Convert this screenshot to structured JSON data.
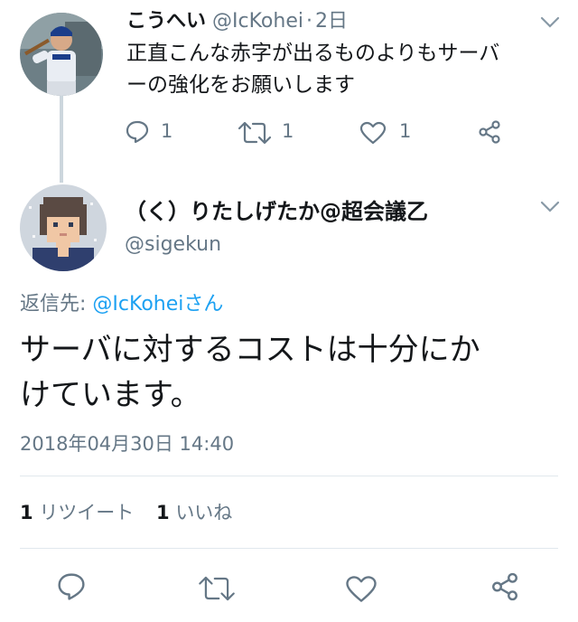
{
  "parent_tweet": {
    "display_name": "こうへい",
    "handle": "@IcKohei",
    "separator": "·",
    "time": "2日",
    "text_line1": "正直こんな赤字が出るものよりもサーバ",
    "text_line2": "ーの強化をお願いします",
    "reply_count": "1",
    "retweet_count": "1",
    "like_count": "1"
  },
  "main_tweet": {
    "display_name": "（く）りたしげたか@超会議乙",
    "handle": "@sigekun",
    "reply_to_label": "返信先: ",
    "reply_to_handle": "@IcKohei",
    "reply_to_suffix": "さん",
    "text_line1": "サーバに対するコストは十分にか",
    "text_line2": "けています。",
    "timestamp": "2018年04月30日 14:40",
    "retweet_count": "1",
    "retweet_label": "リツイート",
    "like_count": "1",
    "like_label": "いいね"
  },
  "colors": {
    "link": "#1da1f2",
    "muted": "#657786",
    "thread_line": "#ccd6dd",
    "divider": "#e1e8ed"
  },
  "icons": [
    "reply-icon",
    "retweet-icon",
    "like-icon",
    "share-icon",
    "chevron-down-icon"
  ]
}
